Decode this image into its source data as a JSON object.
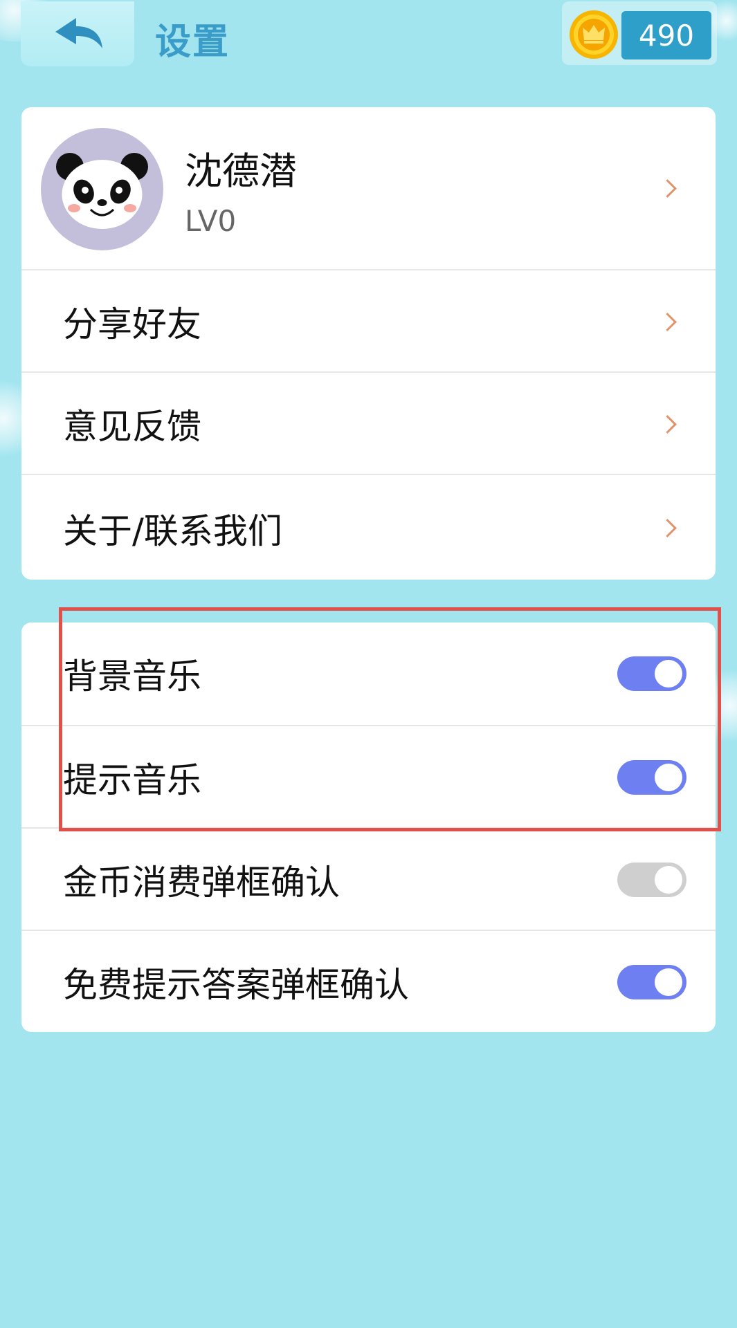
{
  "header": {
    "title": "设置",
    "coins": "490"
  },
  "profile": {
    "name": "沈德潜",
    "level": "LV0"
  },
  "menu": [
    {
      "label": "分享好友"
    },
    {
      "label": "意见反馈"
    },
    {
      "label": "关于/联系我们"
    }
  ],
  "settings": [
    {
      "label": "背景音乐",
      "enabled": true
    },
    {
      "label": "提示音乐",
      "enabled": true
    },
    {
      "label": "金币消费弹框确认",
      "enabled": false
    },
    {
      "label": "免费提示答案弹框确认",
      "enabled": true
    }
  ],
  "colors": {
    "background": "#a2e5ef",
    "accent_title": "#3a9cc8",
    "toggle_on": "#6e7ff1",
    "toggle_off": "#cfcfcf",
    "chevron": "#e0936a",
    "highlight": "#e2504a"
  },
  "icons": {
    "back": "back-arrow-icon",
    "coin": "crown-coin-icon",
    "avatar": "panda-avatar",
    "chevron": "chevron-right-icon"
  }
}
